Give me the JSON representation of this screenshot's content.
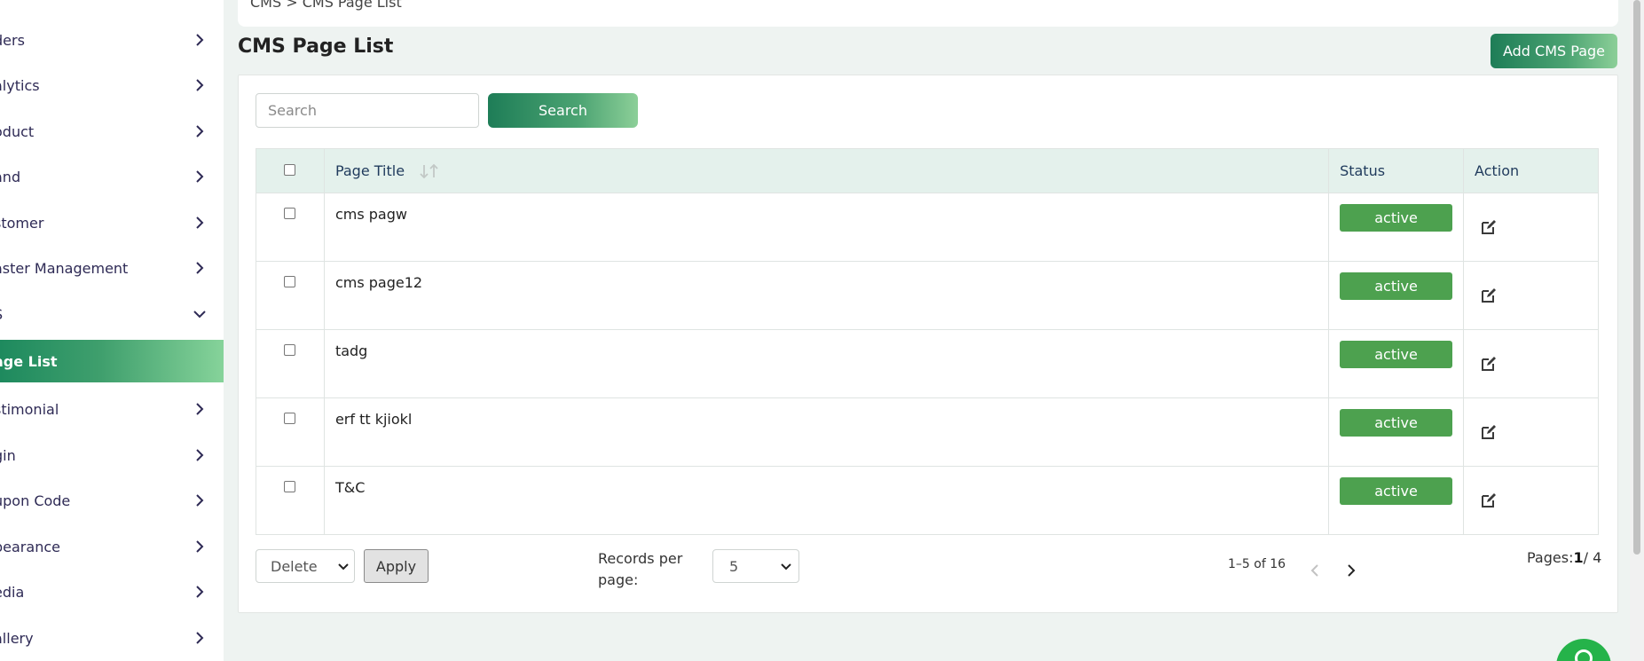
{
  "sidebar": {
    "items": [
      {
        "label": "ders"
      },
      {
        "label": "alytics"
      },
      {
        "label": "oduct"
      },
      {
        "label": "and"
      },
      {
        "label": "stomer"
      },
      {
        "label": "aster Management"
      },
      {
        "label": "S"
      },
      {
        "label": "age List"
      },
      {
        "label": "stimonial"
      },
      {
        "label": "gin"
      },
      {
        "label": "upon Code"
      },
      {
        "label": "pearance"
      },
      {
        "label": "edia"
      },
      {
        "label": "allery"
      }
    ]
  },
  "breadcrumb": "CMS > CMS Page List",
  "page_title": "CMS Page List",
  "add_button": "Add CMS Page",
  "search": {
    "placeholder": "Search",
    "button": "Search"
  },
  "table": {
    "headers": {
      "title": "Page Title",
      "status": "Status",
      "action": "Action"
    },
    "rows": [
      {
        "title": "cms pagw",
        "status": "active"
      },
      {
        "title": "cms page12",
        "status": "active"
      },
      {
        "title": "tadg",
        "status": "active"
      },
      {
        "title": "erf tt kjiokl",
        "status": "active"
      },
      {
        "title": "T&C",
        "status": "active"
      }
    ]
  },
  "footer": {
    "bulk_action": "Delete",
    "apply": "Apply",
    "records_per_page_label": "Records per page:",
    "records_per_page": "5",
    "range": "1–5 of 16",
    "pages_label": "Pages:",
    "current_page": "1",
    "total_pages": "/ 4"
  },
  "colors": {
    "accent": "#1e7d57",
    "status_active": "#4da14f",
    "header_bg": "#e4f1ec"
  },
  "icons": [
    "chevron-right-icon",
    "chevron-down-icon",
    "sort-icon",
    "edit-icon",
    "chevron-left-icon",
    "chat-icon"
  ]
}
